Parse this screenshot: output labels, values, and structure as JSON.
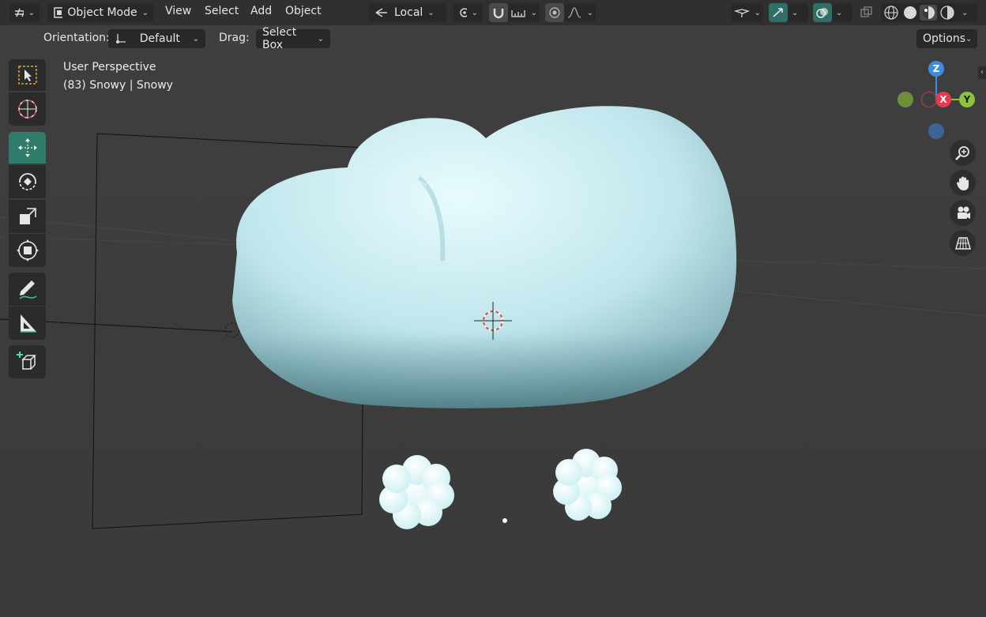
{
  "header": {
    "mode_label": "Object Mode",
    "menus": [
      "View",
      "Select",
      "Add",
      "Object"
    ],
    "pivot_label": "Local",
    "options_label": "Options"
  },
  "toolrow": {
    "orientation_label": "Orientation:",
    "orientation_value": "Default",
    "drag_label": "Drag:",
    "drag_value": "Select Box"
  },
  "viewport": {
    "view_name": "User Perspective",
    "object_info": "(83) Snowy | Snowy"
  },
  "gizmo": {
    "z_label": "Z",
    "x_label": "X",
    "y_label": "Y"
  },
  "colors": {
    "accent": "#2f7c6b",
    "axis_x": "#e8394d",
    "axis_y": "#8bc33a",
    "axis_z": "#3b8de0",
    "cloud": "#bfe9ef"
  },
  "icons": {
    "tools": [
      "select-box-icon",
      "cursor-icon",
      "move-icon",
      "rotate-icon",
      "scale-icon",
      "transform-icon",
      "annotate-icon",
      "measure-icon",
      "add-cube-icon"
    ],
    "nav": [
      "zoom-icon",
      "pan-hand-icon",
      "camera-icon",
      "grid-icon"
    ]
  }
}
